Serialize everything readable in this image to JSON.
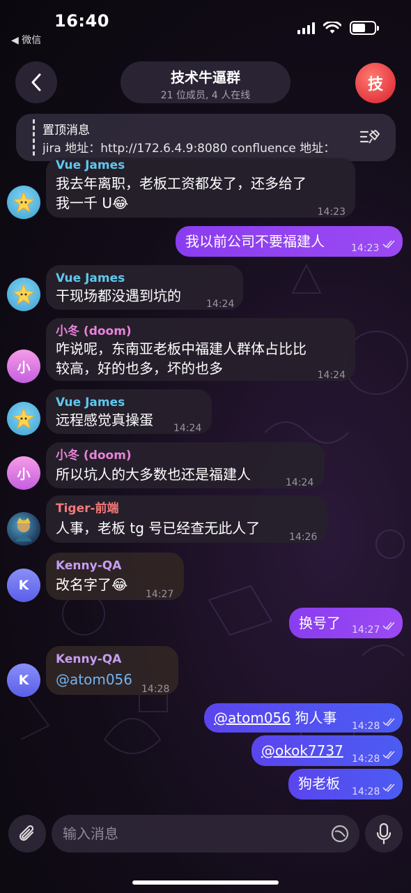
{
  "status_bar": {
    "time": "16:40",
    "back_app": "◀ 微信"
  },
  "header": {
    "title": "技术牛逼群",
    "subtitle": "21 位成员, 4 人在线",
    "group_initial": "技"
  },
  "pinned": {
    "title": "置顶消息",
    "text": "jira 地址：http://172.6.4.9:8080 confluence 地址："
  },
  "messages": [
    {
      "sender": "Vue James",
      "text1": "我去年离职，老板工资都发了，还多给了",
      "text2": "我一千 U",
      "emoji": "😂",
      "time": "14:23"
    },
    {
      "text": "我以前公司不要福建人",
      "time": "14:23"
    },
    {
      "sender": "Vue James",
      "text": "干现场都没遇到坑的",
      "time": "14:24"
    },
    {
      "sender": "小冬 (doom)",
      "text1": "咋说呢，东南亚老板中福建人群体占比比",
      "text2": "较高，好的也多，坏的也多",
      "time": "14:24"
    },
    {
      "sender": "Vue James",
      "text": "远程感觉真操蛋",
      "time": "14:24"
    },
    {
      "sender": "小冬 (doom)",
      "text": "所以坑人的大多数也还是福建人",
      "time": "14:24"
    },
    {
      "sender": "Tiger-前端",
      "text": "人事，老板 tg 号已经查无此人了",
      "time": "14:26"
    },
    {
      "sender": "Kenny-QA",
      "text": "改名字了",
      "emoji": "😂",
      "time": "14:27"
    },
    {
      "text": "换号了",
      "time": "14:27"
    },
    {
      "sender": "Kenny-QA",
      "text": "@atom056",
      "time": "14:28"
    },
    {
      "mention": "@atom056",
      "text": "狗人事",
      "time": "14:28"
    },
    {
      "mention": "@okok7737",
      "time": "14:28"
    },
    {
      "text": "狗老板",
      "time": "14:28"
    }
  ],
  "avatars": {
    "xiaodong": "小",
    "kenny": "K"
  },
  "input": {
    "placeholder": "输入消息"
  },
  "colors": {
    "outgoing_purple": "#9b49f2",
    "outgoing_blue": "#4b5cf2",
    "group_avatar": "#e2353f",
    "vue_name": "#5ec8ee",
    "tiger_name": "#f27a7a"
  }
}
